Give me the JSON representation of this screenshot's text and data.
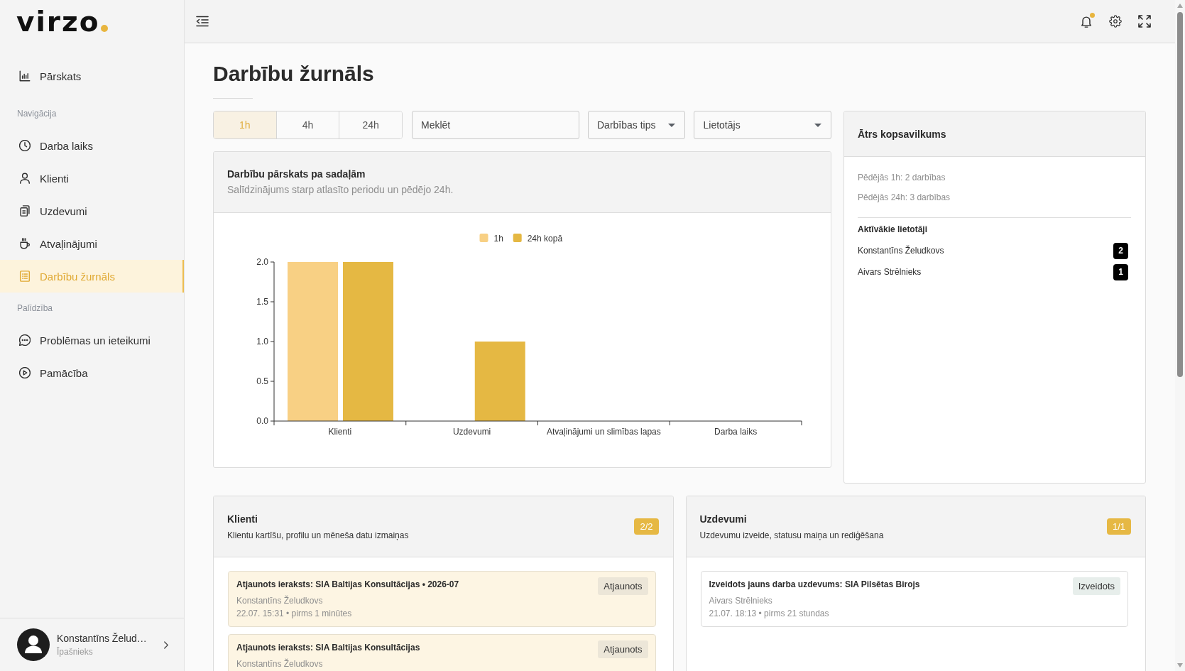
{
  "sidebar": {
    "logo": "virzo",
    "groups": [
      {
        "items": [
          {
            "label": "Pārskats",
            "selected": false
          }
        ]
      },
      {
        "title": "Navigācija",
        "items": [
          {
            "label": "Darba laiks",
            "selected": false
          },
          {
            "label": "Klienti",
            "selected": false
          },
          {
            "label": "Uzdevumi",
            "selected": false
          },
          {
            "label": "Atvaļinājumi",
            "selected": false
          },
          {
            "label": "Darbību žurnāls",
            "selected": true
          }
        ]
      },
      {
        "title": "Palīdzība",
        "items": [
          {
            "label": "Problēmas un ieteikumi",
            "selected": false
          },
          {
            "label": "Pamācība",
            "selected": false
          }
        ]
      }
    ],
    "user": {
      "name": "Konstantīns Želud…",
      "role": "Īpašnieks"
    }
  },
  "topbar": {
    "notifications_unread": true
  },
  "page": {
    "title": "Darbību žurnāls"
  },
  "filters": {
    "periods": [
      {
        "label": "1h",
        "selected": true
      },
      {
        "label": "4h",
        "selected": false
      },
      {
        "label": "24h",
        "selected": false
      }
    ],
    "search": {
      "placeholder": "Meklēt"
    },
    "dropdowns": [
      {
        "label": "Darbības tips"
      },
      {
        "label": "Lietotājs"
      }
    ]
  },
  "overview_chart": {
    "title": "Darbību pārskats pa sadaļām",
    "subtitle": "Salīdzinājums starp atlasīto periodu un pēdējo 24h.",
    "chart_data": {
      "type": "bar",
      "categories": [
        "Klienti",
        "Uzdevumi",
        "Atvaļinājumi un slimības lapas",
        "Darba laiks"
      ],
      "series": [
        {
          "name": "1h",
          "color": "#f8d084",
          "values": [
            2,
            0,
            0,
            0
          ]
        },
        {
          "name": "24h kopā",
          "color": "#e5b843",
          "values": [
            2,
            1,
            0,
            0
          ]
        }
      ],
      "ylim": [
        0,
        2
      ],
      "yticks": [
        {
          "value": 0,
          "label": "0.0"
        },
        {
          "value": 0.5,
          "label": "0.5"
        },
        {
          "value": 1,
          "label": "1.0"
        },
        {
          "value": 1.5,
          "label": "1.5"
        },
        {
          "value": 2,
          "label": "2.0"
        }
      ],
      "legend": "top"
    }
  },
  "summary": {
    "title": "Ātrs kopsavilkums",
    "stats": [
      "Pēdējās 1h: 2 darbības",
      "Pēdējās 24h: 3 darbības"
    ],
    "active_users_title": "Aktīvākie lietotāji",
    "active_users": [
      {
        "name": "Konstantīns Želudkovs",
        "count": "2"
      },
      {
        "name": "Aivars Strēlnieks",
        "count": "1"
      }
    ]
  },
  "log_sections": [
    {
      "title": "Klienti",
      "subtitle": "Klientu kartīšu, profilu un mēneša datu izmaiņas",
      "count": "2/2",
      "entries": [
        {
          "kind": "updated",
          "title": "Atjaunots ieraksts: SIA Baltijas Konsultācijas • 2026-07",
          "badge": "Atjaunots",
          "user": "Konstantīns Želudkovs",
          "time": "22.07. 15:31 • pirms 1 minūtes"
        },
        {
          "kind": "updated",
          "title": "Atjaunots ieraksts: SIA Baltijas Konsultācijas",
          "badge": "Atjaunots",
          "user": "Konstantīns Želudkovs"
        }
      ]
    },
    {
      "title": "Uzdevumi",
      "subtitle": "Uzdevumu izveide, statusu maiņa un rediģēšana",
      "count": "1/1",
      "entries": [
        {
          "kind": "created",
          "title": "Izveidots jauns darba uzdevums: SIA Pilsētas Birojs",
          "badge": "Izveidots",
          "user": "Aivars Strēlnieks",
          "time": "21.07. 18:13 • pirms 21 stundas"
        }
      ]
    }
  ]
}
